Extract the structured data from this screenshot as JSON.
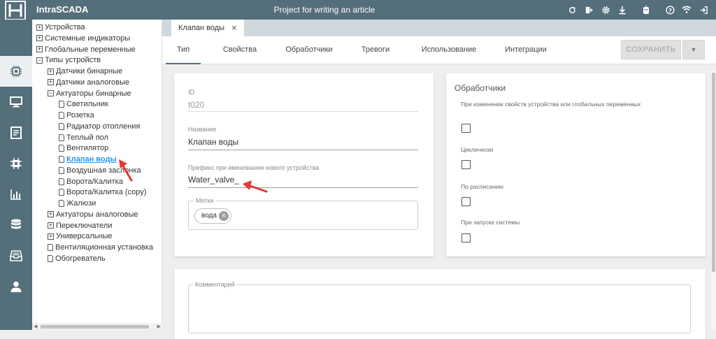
{
  "app": {
    "title": "IntraSCADA",
    "project": "Project for writing an article"
  },
  "tree": {
    "items": [
      {
        "label": "Устройства",
        "type": "plus"
      },
      {
        "label": "Системные индикаторы",
        "type": "plus"
      },
      {
        "label": "Глобальные переменные",
        "type": "plus"
      },
      {
        "label": "Типы устройств",
        "type": "minus"
      },
      {
        "label": "Датчики бинарные",
        "type": "plus"
      },
      {
        "label": "Датчики аналоговые",
        "type": "plus"
      },
      {
        "label": "Актуаторы бинарные",
        "type": "minus"
      },
      {
        "label": "Светильник",
        "type": "file"
      },
      {
        "label": "Розетка",
        "type": "file"
      },
      {
        "label": "Радиатор отопления",
        "type": "file"
      },
      {
        "label": "Теплый пол",
        "type": "file"
      },
      {
        "label": "Вентилятор",
        "type": "file"
      },
      {
        "label": "Клапан воды",
        "type": "file",
        "selected": true
      },
      {
        "label": "Воздушная заслонка",
        "type": "file"
      },
      {
        "label": "Ворота/Калитка",
        "type": "file"
      },
      {
        "label": "Ворота/Калитка (copy)",
        "type": "file"
      },
      {
        "label": "Жалюзи",
        "type": "file"
      },
      {
        "label": "Актуаторы аналоговые",
        "type": "plus"
      },
      {
        "label": "Переключатели",
        "type": "plus"
      },
      {
        "label": "Универсальные",
        "type": "plus"
      },
      {
        "label": "Вентиляционная установка",
        "type": "file"
      },
      {
        "label": "Обогреватель",
        "type": "file"
      }
    ]
  },
  "doc_tab": {
    "label": "Клапан воды"
  },
  "tabs": [
    "Тип",
    "Свойства",
    "Обработчики",
    "Тревоги",
    "Использование",
    "Интеграции"
  ],
  "toolbar": {
    "save_label": "СОХРАНИТЬ"
  },
  "form": {
    "id_label": "ID",
    "id_value": "t020",
    "name_label": "Название",
    "name_value": "Клапан воды",
    "prefix_label": "Префикс при именовании нового устройства",
    "prefix_value": "Water_valve_",
    "tags_label": "Метки",
    "tags": [
      "вода"
    ]
  },
  "handlers": {
    "title": "Обработчики",
    "items": [
      {
        "label": "При изменении свойств устройства или глобальных переменных",
        "checked": false
      },
      {
        "label": "Циклически",
        "checked": false
      },
      {
        "label": "По расписанию",
        "checked": false
      },
      {
        "label": "При запуске системы",
        "checked": false
      }
    ]
  },
  "comment": {
    "label": "Комментарий"
  },
  "colors": {
    "header": "#546e7a",
    "accent": "#2196f3",
    "arrow": "#e53935"
  }
}
